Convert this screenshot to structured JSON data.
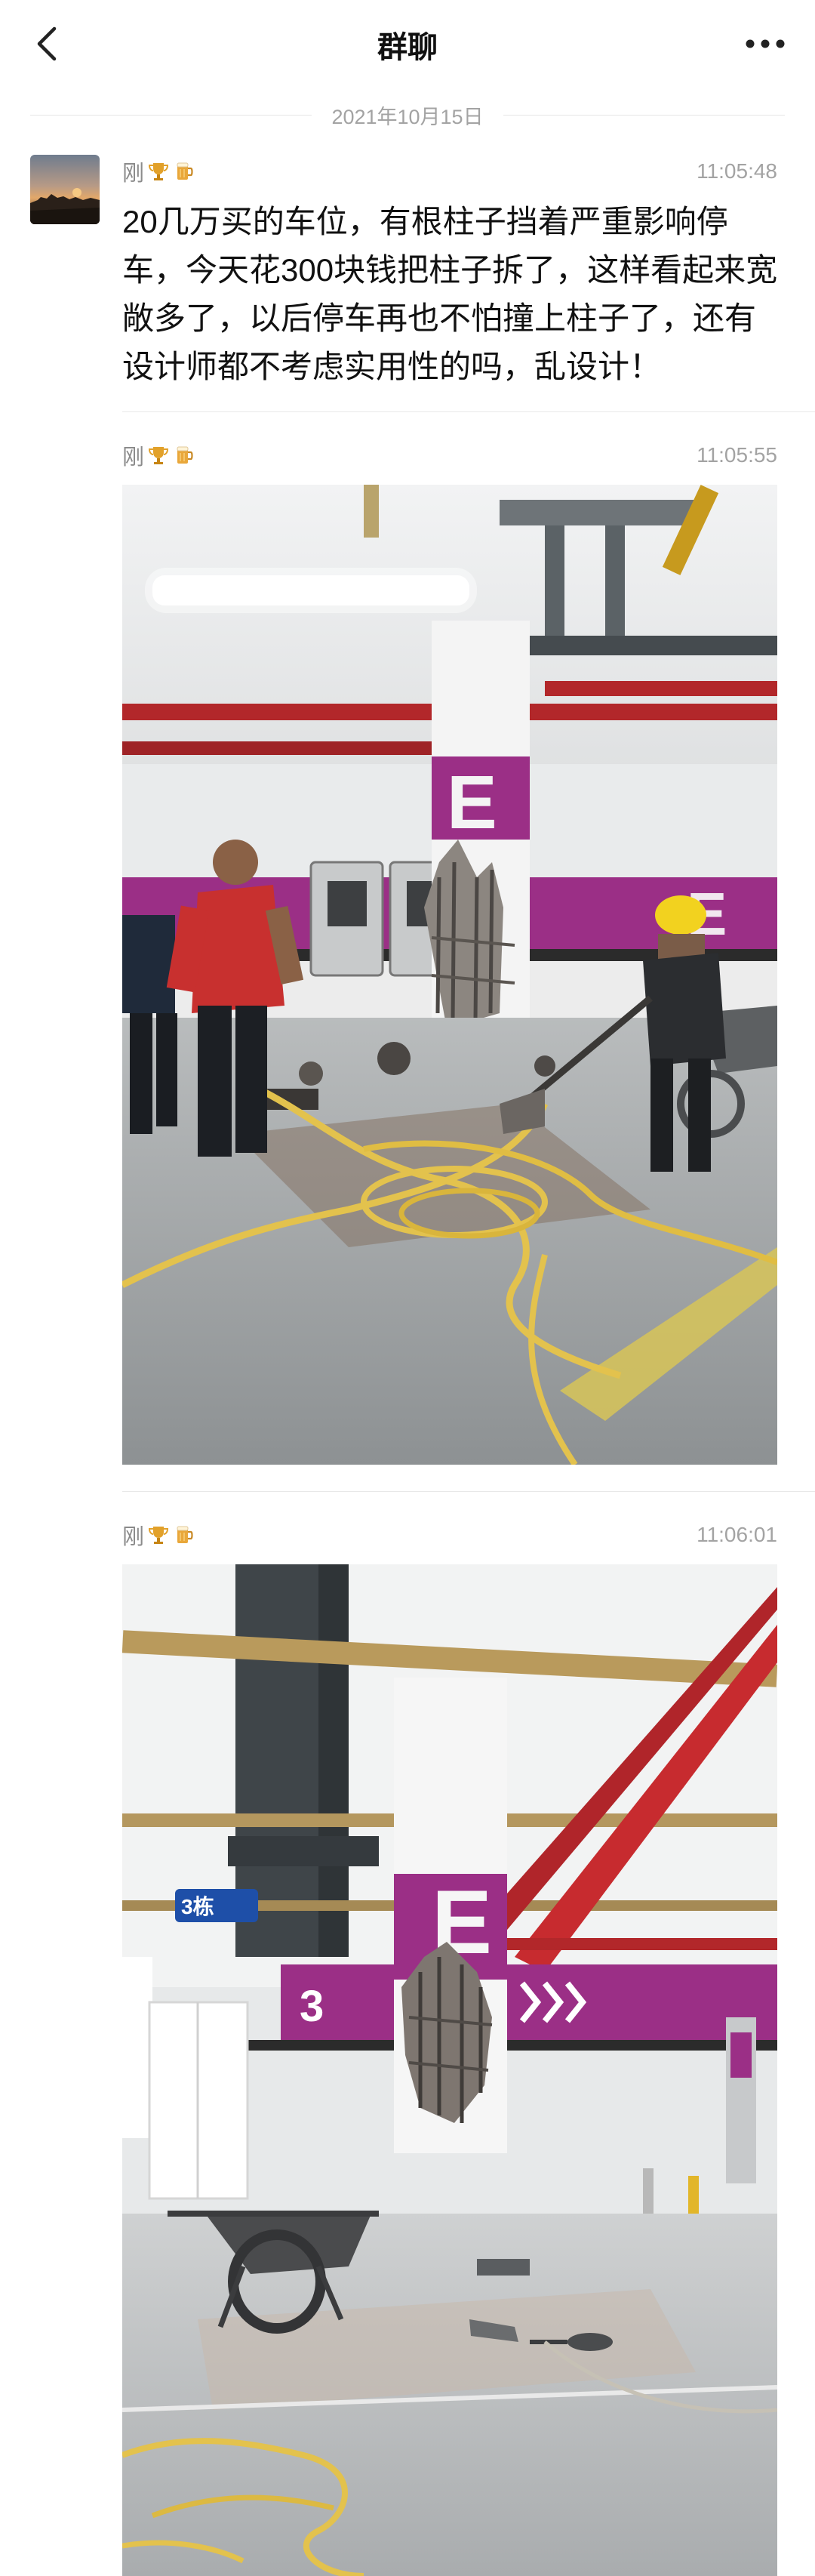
{
  "header": {
    "title": "群聊",
    "back_icon": "chevron-left-icon",
    "more_icon": "more-dots-icon"
  },
  "date_separator": "2021年10月15日",
  "messages": [
    {
      "sender": "刚",
      "time": "11:05:48",
      "text": "20几万买的车位，有根柱子挡着严重影响停车，今天花300块钱把柱子拆了，这样看起来宽敞多了，以后停车再也不怕撞上柱子了，还有设计师都不考虑实用性的吗，乱设计！"
    },
    {
      "sender": "刚",
      "time": "11:05:55",
      "image": "photo-workers-demolishing-pillar",
      "signs": [
        "E",
        "E"
      ]
    },
    {
      "sender": "刚",
      "time": "11:06:01",
      "image": "photo-damaged-pillar-wheelbarrow",
      "signs": [
        "3栋",
        "3",
        "E"
      ]
    }
  ],
  "colors": {
    "accent_purple": "#9b2f86",
    "pipe_red": "#b2272a",
    "hose_yellow": "#e3c24d"
  }
}
